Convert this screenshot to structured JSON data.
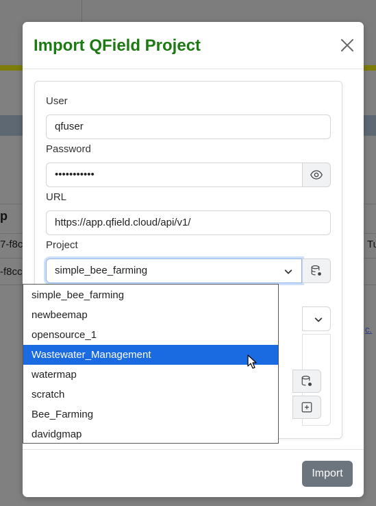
{
  "background": {
    "text_p": "p",
    "text_row1": "7-f8c",
    "text_row2": "-f8cc",
    "text_right": "Tu",
    "link_right": "c."
  },
  "modal": {
    "title": "Import QField Project",
    "close_icon": "close-icon",
    "fields": {
      "user_label": "User",
      "user_value": "qfuser",
      "password_label": "Password",
      "password_value": "•••••••••••",
      "password_toggle_icon": "eye-icon",
      "url_label": "URL",
      "url_value": "https://app.qfield.cloud/api/v1/",
      "project_label": "Project",
      "project_value": "simple_bee_farming",
      "project_action_icon": "database-gear-icon"
    },
    "dropdown_options": [
      "simple_bee_farming",
      "newbeemap",
      "opensource_1",
      "Wastewater_Management",
      "watermap",
      "scratch",
      "Bee_Farming",
      "davidgmap"
    ],
    "highlighted_option": "Wastewater_Management",
    "import_label": "Import"
  },
  "colors": {
    "title": "#1b7a12",
    "highlight": "#1a6ae1",
    "import_button": "#6c757d"
  }
}
